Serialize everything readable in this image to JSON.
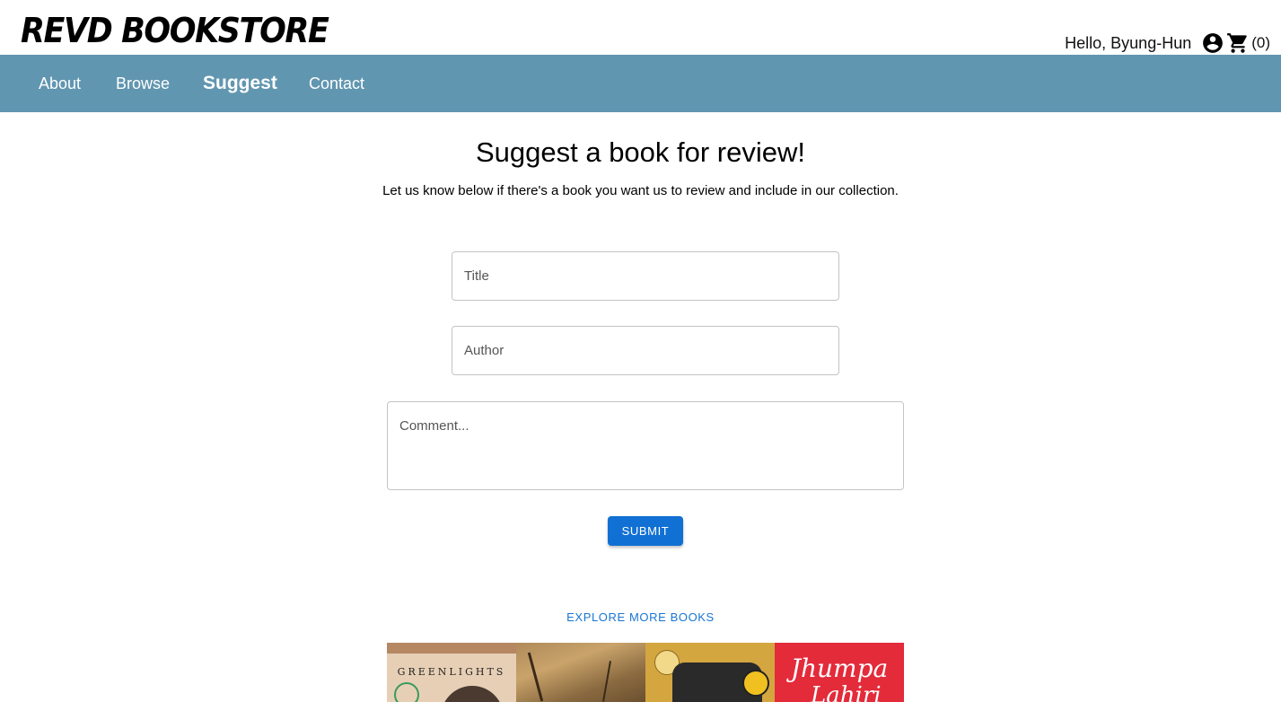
{
  "brand": {
    "name": "REVD BOOKSTORE"
  },
  "user": {
    "greeting": "Hello, Byung-Hun",
    "cart_count": "(0)"
  },
  "nav": {
    "items": [
      {
        "label": "About"
      },
      {
        "label": "Browse"
      },
      {
        "label": "Suggest",
        "active": true
      },
      {
        "label": "Contact"
      }
    ]
  },
  "main": {
    "heading": "Suggest a book for review!",
    "subheading": "Let us know below if there's a book you want us to review and include in our collection.",
    "form": {
      "title_placeholder": "Title",
      "author_placeholder": "Author",
      "comment_placeholder": "Comment...",
      "submit_label": "SUBMIT"
    },
    "explore_label": "EXPLORE MORE BOOKS",
    "covers": [
      {
        "text": "GREENLIGHTS"
      },
      {
        "text": ""
      },
      {
        "text": ""
      },
      {
        "text": "Jhumpa",
        "text2": "Lahiri"
      }
    ]
  },
  "colors": {
    "nav_bg": "#6196b0",
    "accent": "#1170d3",
    "link": "#1976d2"
  }
}
